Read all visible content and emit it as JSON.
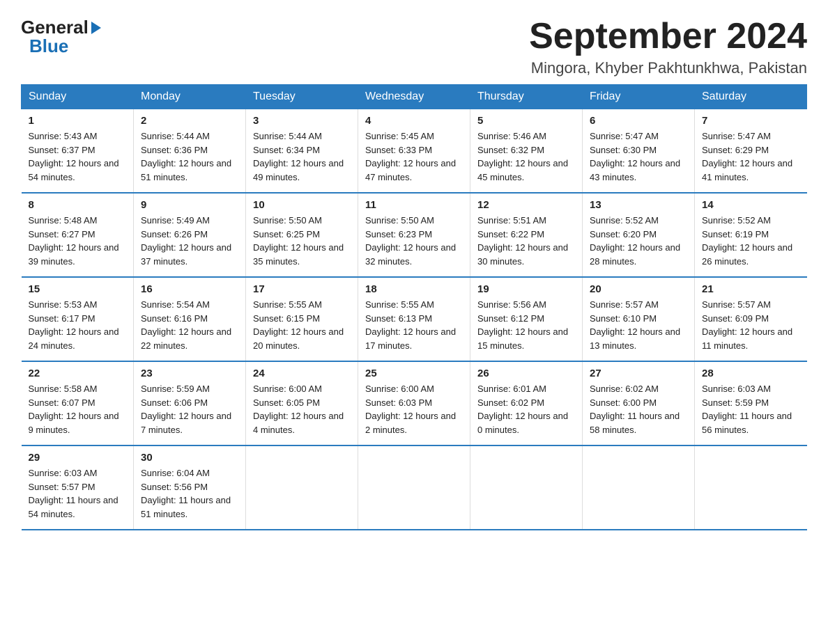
{
  "header": {
    "logo": {
      "general": "General",
      "blue": "Blue",
      "arrow": "▶"
    },
    "title": "September 2024",
    "location": "Mingora, Khyber Pakhtunkhwa, Pakistan"
  },
  "days_of_week": [
    "Sunday",
    "Monday",
    "Tuesday",
    "Wednesday",
    "Thursday",
    "Friday",
    "Saturday"
  ],
  "weeks": [
    [
      {
        "day": "1",
        "sunrise": "Sunrise: 5:43 AM",
        "sunset": "Sunset: 6:37 PM",
        "daylight": "Daylight: 12 hours and 54 minutes."
      },
      {
        "day": "2",
        "sunrise": "Sunrise: 5:44 AM",
        "sunset": "Sunset: 6:36 PM",
        "daylight": "Daylight: 12 hours and 51 minutes."
      },
      {
        "day": "3",
        "sunrise": "Sunrise: 5:44 AM",
        "sunset": "Sunset: 6:34 PM",
        "daylight": "Daylight: 12 hours and 49 minutes."
      },
      {
        "day": "4",
        "sunrise": "Sunrise: 5:45 AM",
        "sunset": "Sunset: 6:33 PM",
        "daylight": "Daylight: 12 hours and 47 minutes."
      },
      {
        "day": "5",
        "sunrise": "Sunrise: 5:46 AM",
        "sunset": "Sunset: 6:32 PM",
        "daylight": "Daylight: 12 hours and 45 minutes."
      },
      {
        "day": "6",
        "sunrise": "Sunrise: 5:47 AM",
        "sunset": "Sunset: 6:30 PM",
        "daylight": "Daylight: 12 hours and 43 minutes."
      },
      {
        "day": "7",
        "sunrise": "Sunrise: 5:47 AM",
        "sunset": "Sunset: 6:29 PM",
        "daylight": "Daylight: 12 hours and 41 minutes."
      }
    ],
    [
      {
        "day": "8",
        "sunrise": "Sunrise: 5:48 AM",
        "sunset": "Sunset: 6:27 PM",
        "daylight": "Daylight: 12 hours and 39 minutes."
      },
      {
        "day": "9",
        "sunrise": "Sunrise: 5:49 AM",
        "sunset": "Sunset: 6:26 PM",
        "daylight": "Daylight: 12 hours and 37 minutes."
      },
      {
        "day": "10",
        "sunrise": "Sunrise: 5:50 AM",
        "sunset": "Sunset: 6:25 PM",
        "daylight": "Daylight: 12 hours and 35 minutes."
      },
      {
        "day": "11",
        "sunrise": "Sunrise: 5:50 AM",
        "sunset": "Sunset: 6:23 PM",
        "daylight": "Daylight: 12 hours and 32 minutes."
      },
      {
        "day": "12",
        "sunrise": "Sunrise: 5:51 AM",
        "sunset": "Sunset: 6:22 PM",
        "daylight": "Daylight: 12 hours and 30 minutes."
      },
      {
        "day": "13",
        "sunrise": "Sunrise: 5:52 AM",
        "sunset": "Sunset: 6:20 PM",
        "daylight": "Daylight: 12 hours and 28 minutes."
      },
      {
        "day": "14",
        "sunrise": "Sunrise: 5:52 AM",
        "sunset": "Sunset: 6:19 PM",
        "daylight": "Daylight: 12 hours and 26 minutes."
      }
    ],
    [
      {
        "day": "15",
        "sunrise": "Sunrise: 5:53 AM",
        "sunset": "Sunset: 6:17 PM",
        "daylight": "Daylight: 12 hours and 24 minutes."
      },
      {
        "day": "16",
        "sunrise": "Sunrise: 5:54 AM",
        "sunset": "Sunset: 6:16 PM",
        "daylight": "Daylight: 12 hours and 22 minutes."
      },
      {
        "day": "17",
        "sunrise": "Sunrise: 5:55 AM",
        "sunset": "Sunset: 6:15 PM",
        "daylight": "Daylight: 12 hours and 20 minutes."
      },
      {
        "day": "18",
        "sunrise": "Sunrise: 5:55 AM",
        "sunset": "Sunset: 6:13 PM",
        "daylight": "Daylight: 12 hours and 17 minutes."
      },
      {
        "day": "19",
        "sunrise": "Sunrise: 5:56 AM",
        "sunset": "Sunset: 6:12 PM",
        "daylight": "Daylight: 12 hours and 15 minutes."
      },
      {
        "day": "20",
        "sunrise": "Sunrise: 5:57 AM",
        "sunset": "Sunset: 6:10 PM",
        "daylight": "Daylight: 12 hours and 13 minutes."
      },
      {
        "day": "21",
        "sunrise": "Sunrise: 5:57 AM",
        "sunset": "Sunset: 6:09 PM",
        "daylight": "Daylight: 12 hours and 11 minutes."
      }
    ],
    [
      {
        "day": "22",
        "sunrise": "Sunrise: 5:58 AM",
        "sunset": "Sunset: 6:07 PM",
        "daylight": "Daylight: 12 hours and 9 minutes."
      },
      {
        "day": "23",
        "sunrise": "Sunrise: 5:59 AM",
        "sunset": "Sunset: 6:06 PM",
        "daylight": "Daylight: 12 hours and 7 minutes."
      },
      {
        "day": "24",
        "sunrise": "Sunrise: 6:00 AM",
        "sunset": "Sunset: 6:05 PM",
        "daylight": "Daylight: 12 hours and 4 minutes."
      },
      {
        "day": "25",
        "sunrise": "Sunrise: 6:00 AM",
        "sunset": "Sunset: 6:03 PM",
        "daylight": "Daylight: 12 hours and 2 minutes."
      },
      {
        "day": "26",
        "sunrise": "Sunrise: 6:01 AM",
        "sunset": "Sunset: 6:02 PM",
        "daylight": "Daylight: 12 hours and 0 minutes."
      },
      {
        "day": "27",
        "sunrise": "Sunrise: 6:02 AM",
        "sunset": "Sunset: 6:00 PM",
        "daylight": "Daylight: 11 hours and 58 minutes."
      },
      {
        "day": "28",
        "sunrise": "Sunrise: 6:03 AM",
        "sunset": "Sunset: 5:59 PM",
        "daylight": "Daylight: 11 hours and 56 minutes."
      }
    ],
    [
      {
        "day": "29",
        "sunrise": "Sunrise: 6:03 AM",
        "sunset": "Sunset: 5:57 PM",
        "daylight": "Daylight: 11 hours and 54 minutes."
      },
      {
        "day": "30",
        "sunrise": "Sunrise: 6:04 AM",
        "sunset": "Sunset: 5:56 PM",
        "daylight": "Daylight: 11 hours and 51 minutes."
      },
      null,
      null,
      null,
      null,
      null
    ]
  ]
}
